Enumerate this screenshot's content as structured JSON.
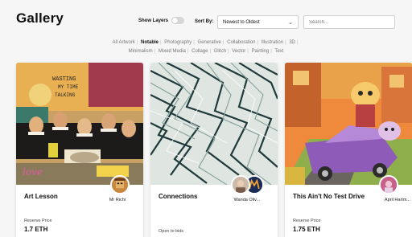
{
  "header": {
    "title": "Gallery",
    "show_layers_label": "Show Layers",
    "sort_label": "Sort By:",
    "sort_value": "Newest to Oldest",
    "search_placeholder": "Search..."
  },
  "filters": [
    {
      "label": "All Artwork",
      "active": false
    },
    {
      "label": "Notable",
      "active": true
    },
    {
      "label": "Photography",
      "active": false
    },
    {
      "label": "Generative",
      "active": false
    },
    {
      "label": "Collaboration",
      "active": false
    },
    {
      "label": "Illustration",
      "active": false
    },
    {
      "label": "3D",
      "active": false
    },
    {
      "label": "Minimalism",
      "active": false
    },
    {
      "label": "Mixed Media",
      "active": false
    },
    {
      "label": "Collage",
      "active": false
    },
    {
      "label": "Glitch",
      "active": false
    },
    {
      "label": "Vector",
      "active": false
    },
    {
      "label": "Painting",
      "active": false
    },
    {
      "label": "Text",
      "active": false
    }
  ],
  "cards": [
    {
      "title": "Art Lesson",
      "artist": "Mr Richi",
      "status_label": "Reserve Price",
      "price": "1.7 ETH"
    },
    {
      "title": "Connections",
      "artist": "Wanda Oliv...",
      "status_label": "Open to bids",
      "price": ""
    },
    {
      "title": "This Ain't No Test Drive",
      "artist": "April Hartm...",
      "status_label": "Reserve Price",
      "price": "1.75 ETH"
    }
  ],
  "colors": {
    "background": "#f6f6f6",
    "card": "#ffffff",
    "accent": "#111111"
  }
}
